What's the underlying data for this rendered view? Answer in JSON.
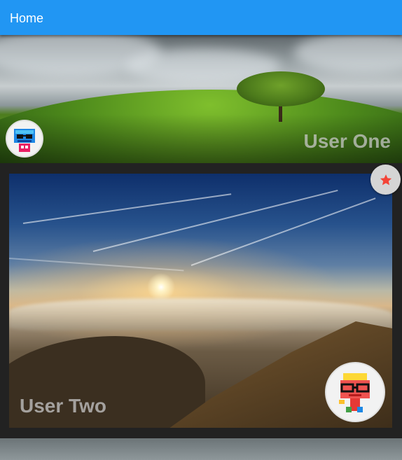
{
  "app_bar": {
    "title": "Home",
    "color": "#2196f3"
  },
  "users": [
    {
      "name": "User One",
      "avatar_icon": "robot-avatar-icon",
      "starred": false
    },
    {
      "name": "User Two",
      "avatar_icon": "nerd-avatar-icon",
      "starred": true
    }
  ],
  "fav_button": {
    "icon": "star-icon",
    "icon_color": "#f44336"
  }
}
